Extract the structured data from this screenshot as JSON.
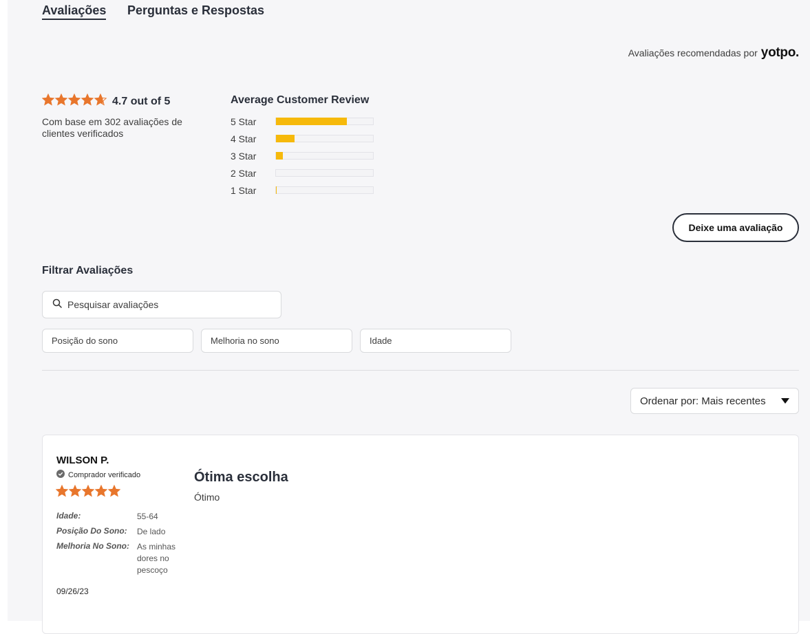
{
  "tabs": [
    {
      "label": "Avaliações",
      "active": true
    },
    {
      "label": "Perguntas e Respostas",
      "active": false
    }
  ],
  "powered_by": {
    "text": "Avaliações recomendadas por",
    "brand": "yotpo."
  },
  "summary": {
    "rating": 4.7,
    "rating_text": "4.7 out of 5",
    "based_on": "Com base em 302 avaliações de clientes verificados",
    "star_color": "#e8762c"
  },
  "histogram": {
    "title": "Average Customer Review",
    "bar_color": "#f6b90b",
    "rows": [
      {
        "label": "5 Star",
        "fraction": 0.73
      },
      {
        "label": "4 Star",
        "fraction": 0.19
      },
      {
        "label": "3 Star",
        "fraction": 0.07
      },
      {
        "label": "2 Star",
        "fraction": 0.0
      },
      {
        "label": "1 Star",
        "fraction": 0.01
      }
    ]
  },
  "write_review_label": "Deixe uma avaliação",
  "filters": {
    "title": "Filtrar Avaliações",
    "search_placeholder": "Pesquisar avaliações",
    "selects": [
      "Posição do sono",
      "Melhoria no sono",
      "Idade"
    ]
  },
  "sort": {
    "label": "Ordenar por: Mais recentes"
  },
  "review": {
    "name": "WILSON P.",
    "verified": "Comprador verificado",
    "stars": 5,
    "attributes": [
      {
        "label": "Idade:",
        "value": "55-64"
      },
      {
        "label": "Posição Do Sono:",
        "value": "De lado"
      },
      {
        "label": "Melhoria No Sono:",
        "value": "As minhas dores no pescoço"
      }
    ],
    "date": "09/26/23",
    "title": "Ótima escolha",
    "body": "Ótimo"
  }
}
